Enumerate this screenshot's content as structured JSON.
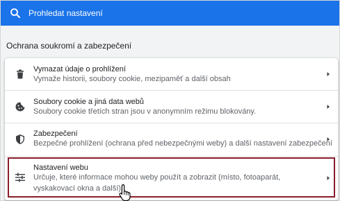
{
  "search": {
    "placeholder": "Prohledat nastavení",
    "icon": "search-icon"
  },
  "section": {
    "title": "Ochrana soukromí a zabezpečení"
  },
  "items": [
    {
      "icon": "trash-icon",
      "title": "Vymazat údaje o prohlížení",
      "subtitle": "Vymaže historii, soubory cookie, mezipaměť a další obsah"
    },
    {
      "icon": "cookie-icon",
      "title": "Soubory cookie a jiná data webů",
      "subtitle": "Soubory cookie třetích stran jsou v anonymním režimu blokovány."
    },
    {
      "icon": "shield-icon",
      "title": "Zabezpečení",
      "subtitle": "Bezpečné prohlížení (ochrana před nebezpečnými weby) a další nastavení zabezpečení"
    },
    {
      "icon": "tune-icon",
      "title": "Nastavení webu",
      "subtitle": "Určuje, které informace mohou weby použít a zobrazit (místo, fotoaparát, vyskakovací okna a další)"
    }
  ],
  "colors": {
    "accent": "#1a73e8",
    "highlight": "#8a1c2a"
  }
}
